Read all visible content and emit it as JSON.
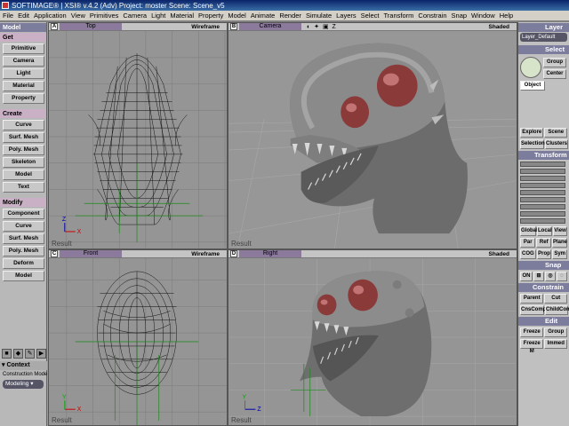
{
  "window": {
    "title": "SOFTIMAGE® | XSI® v.4.2 (Adv) Project: moster   Scene: Scene_v5"
  },
  "menu": [
    "File",
    "Edit",
    "Application",
    "View",
    "Primitives",
    "Camera",
    "Light",
    "Material",
    "Property",
    "Model",
    "Animate",
    "Render",
    "Simulate",
    "Layers",
    "Select",
    "Transform",
    "Constrain",
    "Snap",
    "Window",
    "Help"
  ],
  "left_panel": {
    "mode": "Model",
    "get_header": "Get",
    "get_buttons": [
      "Primitive",
      "Camera",
      "Light",
      "Material",
      "Property"
    ],
    "create_header": "Create",
    "create_buttons": [
      "Curve",
      "Surf. Mesh",
      "Poly. Mesh",
      "Skeleton",
      "Model",
      "Text"
    ],
    "modify_header": "Modify",
    "modify_buttons": [
      "Component",
      "Curve",
      "Surf. Mesh",
      "Poly. Mesh",
      "Deform",
      "Model"
    ],
    "context_header": "Context",
    "construction_label": "Construction Mode",
    "construction_value": "Modeling"
  },
  "viewports": {
    "a": {
      "letter": "A",
      "view": "Top",
      "mode": "Wireframe",
      "footer": "Result"
    },
    "b": {
      "letter": "B",
      "view": "Camera",
      "mode": "Shaded",
      "footer": "Result"
    },
    "c": {
      "letter": "C",
      "view": "Front",
      "mode": "Wireframe",
      "footer": "Result"
    },
    "d": {
      "letter": "D",
      "view": "Right",
      "mode": "Shaded",
      "footer": "Result"
    }
  },
  "right_panel": {
    "layer_header": "Layer",
    "layer_value": "Layer_Default",
    "select_header": "Select",
    "group": "Group",
    "center": "Center",
    "object": "Object",
    "explore": "Explore",
    "scene": "Scene",
    "selection": "Selection",
    "clusters": "Clusters",
    "transform_header": "Transform",
    "global": "Global",
    "local": "Local",
    "view": "View",
    "par": "Par",
    "ref": "Ref",
    "plane": "Plane",
    "cog": "COG",
    "prop": "Prop",
    "sym": "Sym",
    "snap_header": "Snap",
    "snap_on": "ON",
    "constrain_header": "Constrain",
    "parent": "Parent",
    "cut": "Cut",
    "cnscomp": "CnsComp",
    "childcomp": "ChildComp",
    "edit_header": "Edit",
    "freeze": "Freeze",
    "group2": "Group",
    "freeze_m": "Freeze M",
    "immed": "Immed"
  }
}
